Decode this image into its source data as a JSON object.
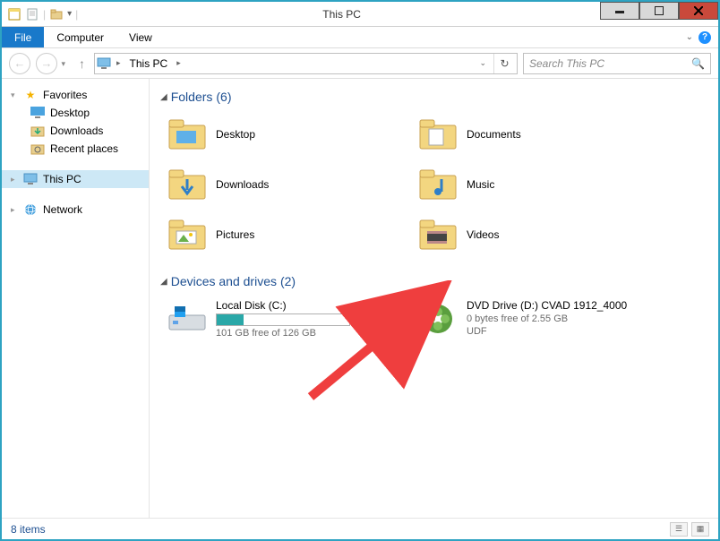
{
  "window": {
    "title": "This PC"
  },
  "ribbon": {
    "file": "File",
    "tabs": [
      "Computer",
      "View"
    ]
  },
  "address": {
    "crumb": "This PC"
  },
  "search": {
    "placeholder": "Search This PC"
  },
  "sidebar": {
    "favorites": {
      "label": "Favorites",
      "items": [
        "Desktop",
        "Downloads",
        "Recent places"
      ]
    },
    "thispc": {
      "label": "This PC"
    },
    "network": {
      "label": "Network"
    }
  },
  "groups": {
    "folders": {
      "title": "Folders",
      "count": "(6)",
      "items": [
        "Desktop",
        "Documents",
        "Downloads",
        "Music",
        "Pictures",
        "Videos"
      ]
    },
    "drives": {
      "title": "Devices and drives",
      "count": "(2)",
      "localdisk": {
        "label": "Local Disk (C:)",
        "sub": "101 GB free of 126 GB",
        "fill_pct": 20
      },
      "dvd": {
        "label": "DVD Drive (D:) CVAD 1912_4000",
        "sub1": "0 bytes free of 2.55 GB",
        "sub2": "UDF"
      }
    }
  },
  "statusbar": {
    "text": "8 items"
  }
}
